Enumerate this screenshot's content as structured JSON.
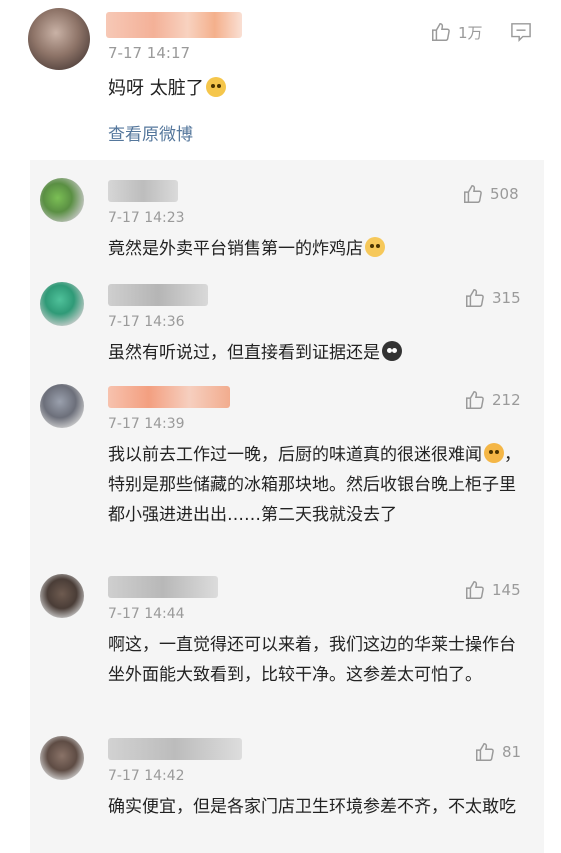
{
  "top_comment": {
    "time": "7-17 14:17",
    "text": "妈呀 太脏了",
    "view_original": "查看原微博",
    "likes": "1万"
  },
  "replies": [
    {
      "time": "7-17 14:23",
      "text": "竟然是外卖平台销售第一的炸鸡店",
      "emoji": "smirk-face",
      "likes": "508"
    },
    {
      "time": "7-17 14:36",
      "text": "虽然有听说过，但直接看到证据还是",
      "emoji": "black-face",
      "likes": "315"
    },
    {
      "time": "7-17 14:39",
      "text_1": "我以前去工作过一晚，后厨的味道真的很迷很难闻",
      "text_2": "，特别是那些储藏的冰箱那块地。然后收银台晚上柜子里都小强进进出出……第二天我就没去了",
      "emoji": "blush-face",
      "likes": "212"
    },
    {
      "time": "7-17 14:44",
      "text": "啊这，一直觉得还可以来着，我们这边的华莱士操作台坐外面能大致看到，比较干净。这参差太可怕了。",
      "likes": "145"
    },
    {
      "time": "7-17 14:42",
      "text": "确实便宜，但是各家门店卫生环境参差不齐，不太敢吃",
      "likes": "81"
    }
  ],
  "colors": {
    "link": "#55779c",
    "meta": "#9a9a9a",
    "reply_bg": "#f5f5f5"
  }
}
